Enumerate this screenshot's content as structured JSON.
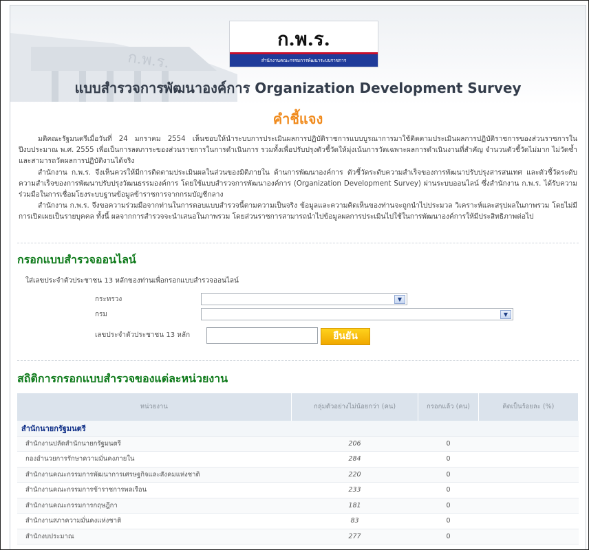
{
  "header": {
    "logo_text": "ก.พ.ร.",
    "logo_sub": "สำนักงานคณะกรรมการพัฒนาระบบราชการ",
    "title": "แบบสำรวจการพัฒนาองค์การ Organization Development Survey"
  },
  "intro": {
    "heading": "คำชี้แจง",
    "paragraphs": [
      "มติคณะรัฐมนตรีเมื่อวันที่ 24 มกราคม 2554 เห็นชอบให้นำระบบการประเมินผลการปฏิบัติราชการแบบบูรณาการมาใช้ติดตามประเมินผลการปฏิบัติราชการของส่วนราชการในปีงบประมาณ พ.ศ. 2555 เพื่อเป็นการลดภาระของส่วนราชการในการดำเนินการ รวมทั้งเพื่อปรับปรุงตัวชี้วัดให้มุ่งเน้นการวัดเฉพาะผลการดำเนินงานที่สำคัญ จำนวนตัวชี้วัดไม่มาก ไม่วัดซ้ำ และสามารถวัดผลการปฏิบัติงานได้จริง",
      "สำนักงาน ก.พ.ร. จึงเห็นควรให้มีการติดตามประเมินผลในส่วนของมิติภายใน ด้านการพัฒนาองค์การ ตัวชี้วัดระดับความสำเร็จของการพัฒนาปรับปรุงสารสนเทศ และตัวชี้วัดระดับความสำเร็จของการพัฒนาปรับปรุงวัฒนธรรมองค์การ โดยใช้แบบสำรวจการพัฒนาองค์การ (Organization Development Survey) ผ่านระบบออนไลน์ ซึ่งสำนักงาน ก.พ.ร. ได้รับความร่วมมือในการเชื่อมโยงระบบฐานข้อมูลข้าราชการจากกรมบัญชีกลาง",
      "สำนักงาน ก.พ.ร. จึงขอความร่วมมือจากท่านในการตอบแบบสำรวจนี้ตามความเป็นจริง ข้อมูลและความคิดเห็นของท่านจะถูกนำไปประมวล วิเคราะห์และสรุปผลในภาพรวม โดยไม่มีการเปิดเผยเป็นรายบุคคล ทั้งนี้ ผลจากการสำรวจจะนำเสนอในภาพรวม โดยส่วนราชการสามารถนำไปข้อมูลผลการประเมินไปใช้ในการพัฒนาองค์การให้มีประสิทธิภาพต่อไป"
    ]
  },
  "online_form": {
    "heading": "กรอกแบบสำรวจออนไลน์",
    "note": "ใส่เลขประจำตัวประชาชน 13 หลักของท่านเพื่อกรอกแบบสำรวจออนไลน์",
    "ministry_label": "กระทรวง",
    "department_label": "กรม",
    "id_label": "เลขประจำตัวประชาชน 13 หลัก",
    "id_value": "",
    "confirm_label": "ยืนยัน"
  },
  "stats": {
    "heading": "สถิติการกรอกแบบสำรวจของแต่ละหน่วยงาน",
    "columns": [
      "หน่วยงาน",
      "กลุ่มตัวอย่างไม่น้อยกว่า (คน)",
      "กรอกแล้ว (คน)",
      "คิดเป็นร้อยละ (%)"
    ],
    "group_name": "สำนักนายกรัฐมนตรี",
    "rows": [
      {
        "name": "สำนักงานปลัดสำนักนายกรัฐมนตรี",
        "sample": "206",
        "done": "0",
        "pct": ""
      },
      {
        "name": "กองอำนวยการรักษาความมั่นคงภายใน",
        "sample": "284",
        "done": "0",
        "pct": ""
      },
      {
        "name": "สำนักงานคณะกรรมการพัฒนาการเศรษฐกิจและสังคมแห่งชาติ",
        "sample": "220",
        "done": "0",
        "pct": ""
      },
      {
        "name": "สำนักงานคณะกรรมการข้าราชการพลเรือน",
        "sample": "233",
        "done": "0",
        "pct": ""
      },
      {
        "name": "สำนักงานคณะกรรมการกฤษฎีกา",
        "sample": "181",
        "done": "0",
        "pct": ""
      },
      {
        "name": "สำนักงานสภาความมั่นคงแห่งชาติ",
        "sample": "83",
        "done": "0",
        "pct": ""
      },
      {
        "name": "สำนักงบประมาณ",
        "sample": "277",
        "done": "0",
        "pct": ""
      }
    ]
  }
}
